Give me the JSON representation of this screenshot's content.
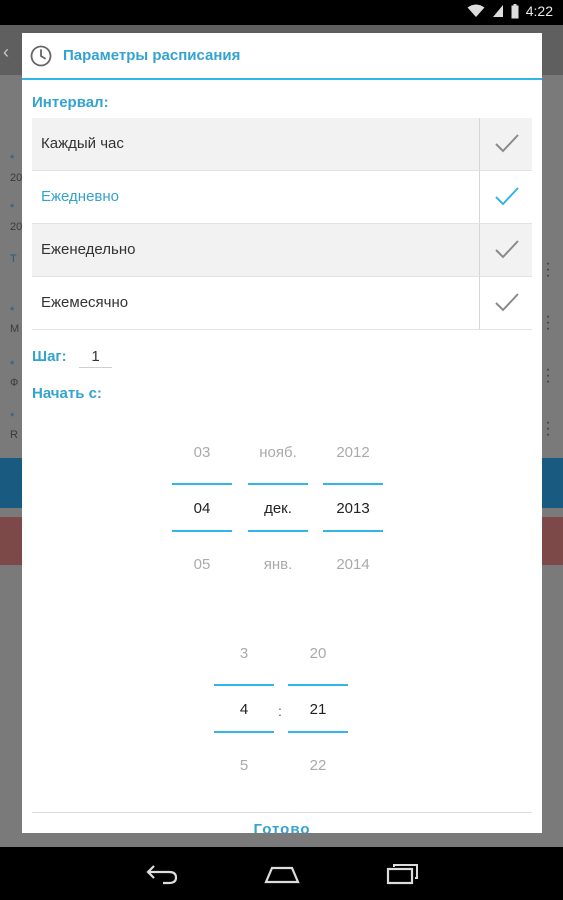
{
  "status_bar": {
    "time": "4:22"
  },
  "dialog": {
    "title": "Параметры расписания",
    "interval_label": "Интервал:",
    "interval_options": [
      {
        "label": "Каждый час",
        "selected": false
      },
      {
        "label": "Ежедневно",
        "selected": true
      },
      {
        "label": "Еженедельно",
        "selected": false
      },
      {
        "label": "Ежемесячно",
        "selected": false
      }
    ],
    "step_label": "Шаг:",
    "step_value": "1",
    "start_label": "Начать с:",
    "date_picker": {
      "day": {
        "prev": "03",
        "current": "04",
        "next": "05"
      },
      "month": {
        "prev": "нояб.",
        "current": "дек.",
        "next": "янв."
      },
      "year": {
        "prev": "2012",
        "current": "2013",
        "next": "2014"
      }
    },
    "time_picker": {
      "hour": {
        "prev": "3",
        "current": "4",
        "next": "5"
      },
      "separator": ":",
      "minute": {
        "prev": "20",
        "current": "21",
        "next": "22"
      }
    },
    "done_button": "Готово"
  },
  "background": {
    "fragments": [
      "*",
      "20",
      "*",
      "20",
      "Т",
      "*",
      "М",
      "*",
      "Ф",
      "*",
      "R"
    ]
  },
  "colors": {
    "accent": "#33b5e5",
    "accent_text": "#33a3cf",
    "row_shade": "#f2f2f2"
  },
  "icons": {
    "header": "clock-icon",
    "row_check": "checkmark-icon",
    "nav": [
      "back-icon",
      "home-icon",
      "recent-apps-icon"
    ]
  }
}
